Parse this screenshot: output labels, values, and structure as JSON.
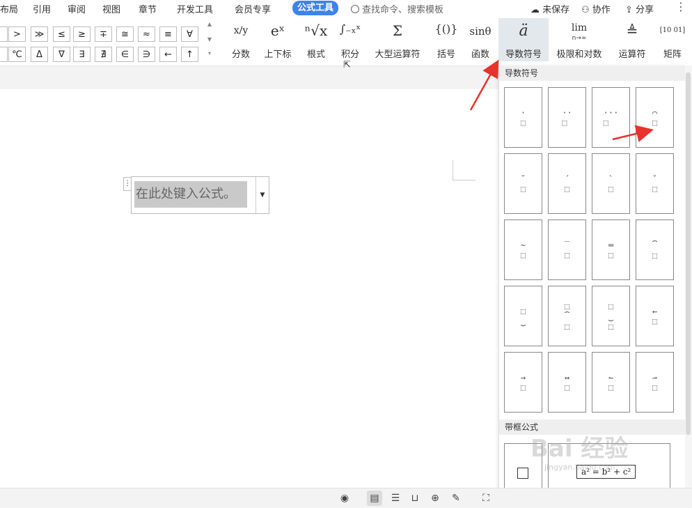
{
  "menubar": {
    "items": [
      "布局",
      "引用",
      "审阅",
      "视图",
      "章节",
      "开发工具",
      "会员专享"
    ],
    "active": "公式工具",
    "search_placeholder": "查找命令、搜索模板",
    "unsaved": "未保存",
    "collab": "协作",
    "share": "分享",
    "more": "⋮"
  },
  "symbols": {
    "row1": [
      ">",
      "≫",
      "≤",
      "≥",
      "∓",
      "≅",
      "≈",
      "≡",
      "∀"
    ],
    "row2": [
      "℃",
      "Δ",
      "∇",
      "∃",
      "∄",
      "∈",
      "∋",
      "←",
      "↑"
    ]
  },
  "tools": [
    {
      "glyph": "x/y",
      "label": "分数"
    },
    {
      "glyph": "eˣ",
      "label": "上下标"
    },
    {
      "glyph": "ⁿ√x",
      "label": "根式"
    },
    {
      "glyph": "∫₋ₓˣ",
      "label": "积分"
    },
    {
      "glyph": "Σ",
      "label": "大型运算符"
    },
    {
      "glyph": "{()}",
      "label": "括号"
    },
    {
      "glyph": "sinθ",
      "label": "函数"
    },
    {
      "glyph": "ä",
      "label": "导数符号"
    },
    {
      "glyph": "lim",
      "label": "极限和对数"
    },
    {
      "glyph": "≜",
      "label": "运算符"
    },
    {
      "glyph": "[10 01]",
      "label": "矩阵"
    }
  ],
  "lim_sub": "n→∞",
  "equation": {
    "placeholder": "在此处键入公式。"
  },
  "panel": {
    "header": "导数符号",
    "header2": "带框公式",
    "box_formula": "a² = b² + c²"
  },
  "watermark": {
    "main": "Bai 经验",
    "sub": "jingyan.baidu.com"
  },
  "accent_color": "#3e83e8",
  "arrow_color": "#e8322b"
}
